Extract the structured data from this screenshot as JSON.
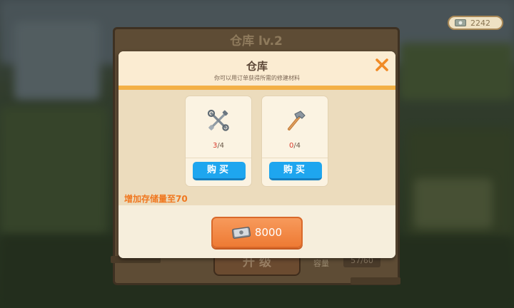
{
  "currency": {
    "amount": "2242",
    "icon": "cash-icon"
  },
  "background_panel": {
    "title": "仓库 lv.2",
    "upgrade_label": "升 级",
    "capacity_label": "容量",
    "capacity_value": "57/60"
  },
  "dialog": {
    "title": "仓库",
    "subtitle": "你可以用订单获得所需的修建材料",
    "close_icon": "close-icon",
    "items": [
      {
        "icon": "tools-icon",
        "have": "3",
        "need": "/4",
        "buy_label": "购买"
      },
      {
        "icon": "hammer-icon",
        "have": "0",
        "need": "/4",
        "buy_label": "购买"
      }
    ],
    "storage_text": "增加存储量至70",
    "price": "8000"
  },
  "colors": {
    "accent_orange": "#f3b046",
    "buy_blue": "#1ea6ef",
    "price_orange": "#ee7a34",
    "shortage_red": "#d93a2c",
    "storage_text_orange": "#f07820"
  }
}
